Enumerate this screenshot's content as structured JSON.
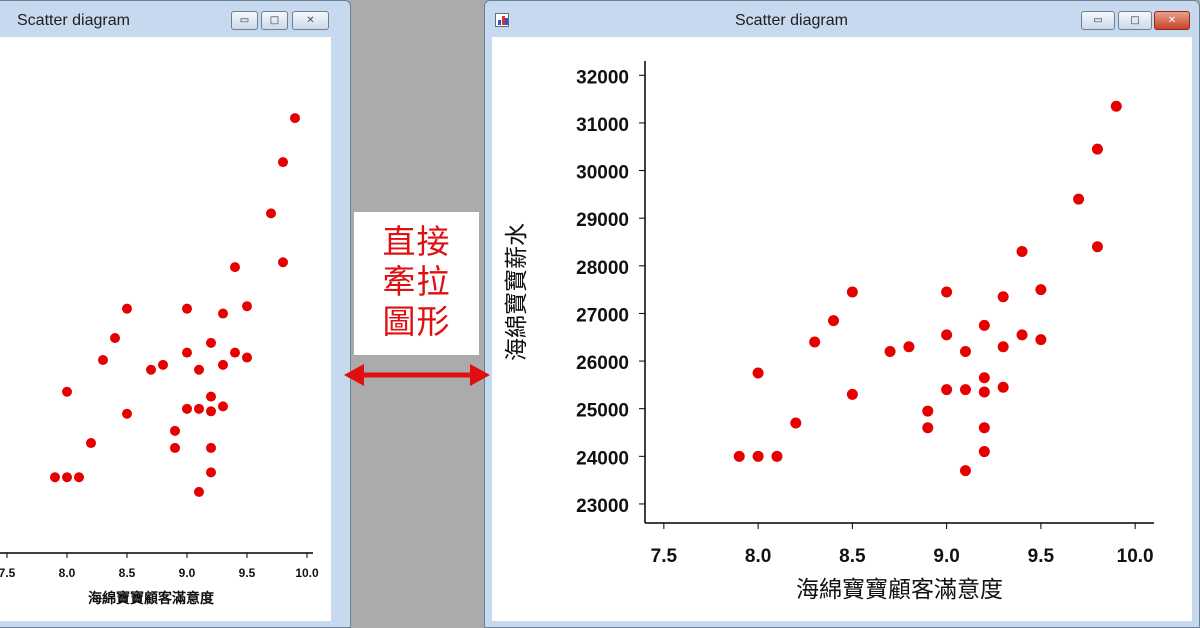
{
  "windows": {
    "left": {
      "title": "Scatter diagram"
    },
    "right": {
      "title": "Scatter diagram"
    }
  },
  "controls": {
    "minimize": "▭",
    "maximize": "□",
    "close": "✕"
  },
  "annotation": {
    "lines": [
      "直接",
      "牽拉",
      "圖形"
    ],
    "color": "#e01010",
    "arrow_icon": "double-arrow-icon"
  },
  "chart_data": [
    {
      "type": "scatter",
      "xlabel": "海綿寶寶顧客滿意度",
      "ylabel": "",
      "xlim": [
        7.4,
        10.05
      ],
      "ylim": [
        22450,
        32600
      ],
      "xticks": [
        "7.5",
        "8.0",
        "8.5",
        "9.0",
        "9.5",
        "10.0"
      ],
      "yticks": [],
      "color": "#e60000",
      "points": [
        [
          7.9,
          24000
        ],
        [
          8.0,
          24000
        ],
        [
          8.1,
          24000
        ],
        [
          8.0,
          25750
        ],
        [
          8.2,
          24700
        ],
        [
          8.3,
          26400
        ],
        [
          8.4,
          26850
        ],
        [
          8.5,
          27450
        ],
        [
          8.5,
          25300
        ],
        [
          8.7,
          26200
        ],
        [
          8.8,
          26300
        ],
        [
          8.9,
          24950
        ],
        [
          8.9,
          24600
        ],
        [
          9.0,
          27450
        ],
        [
          9.0,
          26550
        ],
        [
          9.0,
          25400
        ],
        [
          9.1,
          26200
        ],
        [
          9.1,
          25400
        ],
        [
          9.1,
          23700
        ],
        [
          9.2,
          26750
        ],
        [
          9.2,
          25650
        ],
        [
          9.2,
          25350
        ],
        [
          9.2,
          24600
        ],
        [
          9.2,
          24100
        ],
        [
          9.3,
          27350
        ],
        [
          9.3,
          26300
        ],
        [
          9.3,
          25450
        ],
        [
          9.4,
          28300
        ],
        [
          9.4,
          26550
        ],
        [
          9.5,
          27500
        ],
        [
          9.5,
          26450
        ],
        [
          9.7,
          29400
        ],
        [
          9.8,
          30450
        ],
        [
          9.8,
          28400
        ],
        [
          9.9,
          31350
        ]
      ]
    },
    {
      "type": "scatter",
      "xlabel": "海綿寶寶顧客滿意度",
      "ylabel": "海綿寶寶薪水",
      "xlim": [
        7.4,
        10.1
      ],
      "ylim": [
        22600,
        32300
      ],
      "xticks": [
        "7.5",
        "8.0",
        "8.5",
        "9.0",
        "9.5",
        "10.0"
      ],
      "yticks": [
        "23000",
        "24000",
        "25000",
        "26000",
        "27000",
        "28000",
        "29000",
        "30000",
        "31000",
        "32000"
      ],
      "color": "#e60000",
      "points": [
        [
          7.9,
          24000
        ],
        [
          8.0,
          24000
        ],
        [
          8.1,
          24000
        ],
        [
          8.0,
          25750
        ],
        [
          8.2,
          24700
        ],
        [
          8.3,
          26400
        ],
        [
          8.4,
          26850
        ],
        [
          8.5,
          27450
        ],
        [
          8.5,
          25300
        ],
        [
          8.7,
          26200
        ],
        [
          8.8,
          26300
        ],
        [
          8.9,
          24950
        ],
        [
          8.9,
          24600
        ],
        [
          9.0,
          27450
        ],
        [
          9.0,
          26550
        ],
        [
          9.0,
          25400
        ],
        [
          9.1,
          26200
        ],
        [
          9.1,
          25400
        ],
        [
          9.1,
          23700
        ],
        [
          9.2,
          26750
        ],
        [
          9.2,
          25650
        ],
        [
          9.2,
          25350
        ],
        [
          9.2,
          24600
        ],
        [
          9.2,
          24100
        ],
        [
          9.3,
          27350
        ],
        [
          9.3,
          26300
        ],
        [
          9.3,
          25450
        ],
        [
          9.4,
          28300
        ],
        [
          9.4,
          26550
        ],
        [
          9.5,
          27500
        ],
        [
          9.5,
          26450
        ],
        [
          9.7,
          29400
        ],
        [
          9.8,
          30450
        ],
        [
          9.8,
          28400
        ],
        [
          9.9,
          31350
        ]
      ]
    }
  ]
}
